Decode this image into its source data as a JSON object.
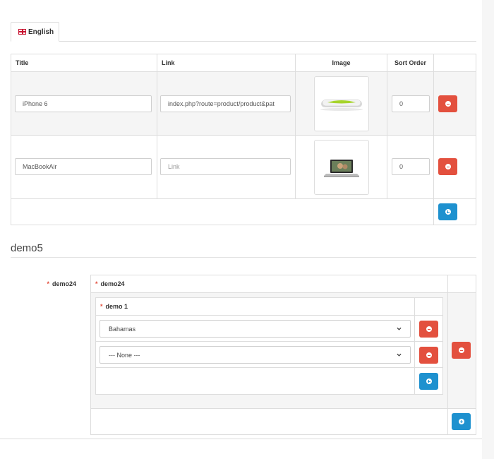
{
  "language_tab": {
    "label": "English",
    "flag_icon": "uk-flag-icon"
  },
  "banner_table": {
    "headers": [
      "Title",
      "Link",
      "Image",
      "Sort Order"
    ],
    "rows": [
      {
        "title": "iPhone 6",
        "link": "index.php?route=product/product&pat",
        "link_placeholder": "Link",
        "image": "iphone-6-thumbnail",
        "sort_order": "0"
      },
      {
        "title": "MacBookAir",
        "link": "",
        "link_placeholder": "Link",
        "image": "macbook-air-thumbnail",
        "sort_order": "0"
      }
    ]
  },
  "section": {
    "title": "demo5"
  },
  "demo24": {
    "field_label": "demo24",
    "inner_header": "demo24",
    "nested_header": "demo 1",
    "selects": [
      "Bahamas",
      "--- None ---"
    ]
  },
  "colors": {
    "danger": "#e3503e",
    "primary": "#1e91cf"
  }
}
